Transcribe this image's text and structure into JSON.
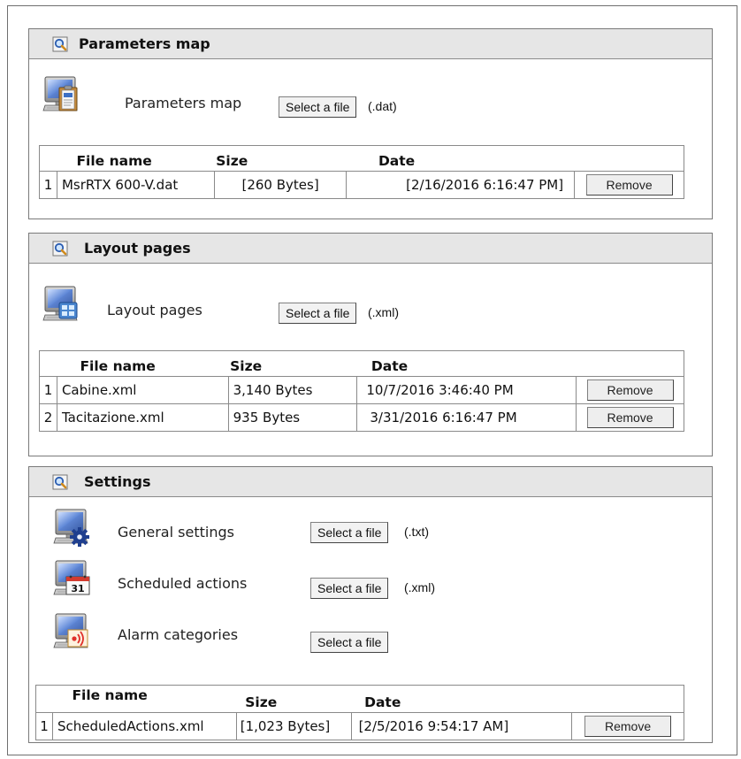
{
  "panels": {
    "parameters": {
      "title": "Parameters map",
      "items": [
        {
          "label": "Parameters map",
          "button": "Select a file",
          "ext": "(.dat)",
          "icon": "parameters-map-icon"
        }
      ],
      "table": {
        "headers": [
          "File name",
          "Size",
          "Date"
        ],
        "rows": [
          {
            "index": "1",
            "name": "MsrRTX 600-V.dat",
            "size": "[260 Bytes]",
            "date": "[2/16/2016 6:16:47 PM]",
            "action": "Remove"
          }
        ]
      }
    },
    "layout": {
      "title": "Layout pages",
      "items": [
        {
          "label": "Layout pages",
          "button": "Select a file",
          "ext": "(.xml)",
          "icon": "layout-pages-icon"
        }
      ],
      "table": {
        "headers": [
          "File name",
          "Size",
          "Date"
        ],
        "rows": [
          {
            "index": "1",
            "name": "Cabine.xml",
            "size": "3,140 Bytes",
            "date": "10/7/2016 3:46:40 PM",
            "action": "Remove"
          },
          {
            "index": "2",
            "name": "Tacitazione.xml",
            "size": "935 Bytes",
            "date": "3/31/2016 6:16:47 PM",
            "action": "Remove"
          }
        ]
      }
    },
    "settings": {
      "title": "Settings",
      "items": [
        {
          "label": "General settings",
          "button": "Select a file",
          "ext": "(.txt)",
          "icon": "general-settings-icon"
        },
        {
          "label": "Scheduled actions",
          "button": "Select a file",
          "ext": "(.xml)",
          "icon": "scheduled-actions-icon",
          "calendar_number": "31"
        },
        {
          "label": "Alarm categories",
          "button": "Select a file",
          "ext": "",
          "icon": "alarm-categories-icon"
        }
      ],
      "table": {
        "headers": [
          "File name",
          "Size",
          "Date"
        ],
        "rows": [
          {
            "index": "1",
            "name": "ScheduledActions.xml",
            "size": "[1,023 Bytes]",
            "date": "[2/5/2016 9:54:17 AM]",
            "action": "Remove"
          }
        ]
      }
    }
  },
  "colors": {
    "header_bg": "#e6e6e6",
    "border": "#7a7a7a",
    "monitor_blue": "#2f5aa8",
    "gear_blue": "#1f3f8f",
    "alarm_red": "#e0302a"
  }
}
